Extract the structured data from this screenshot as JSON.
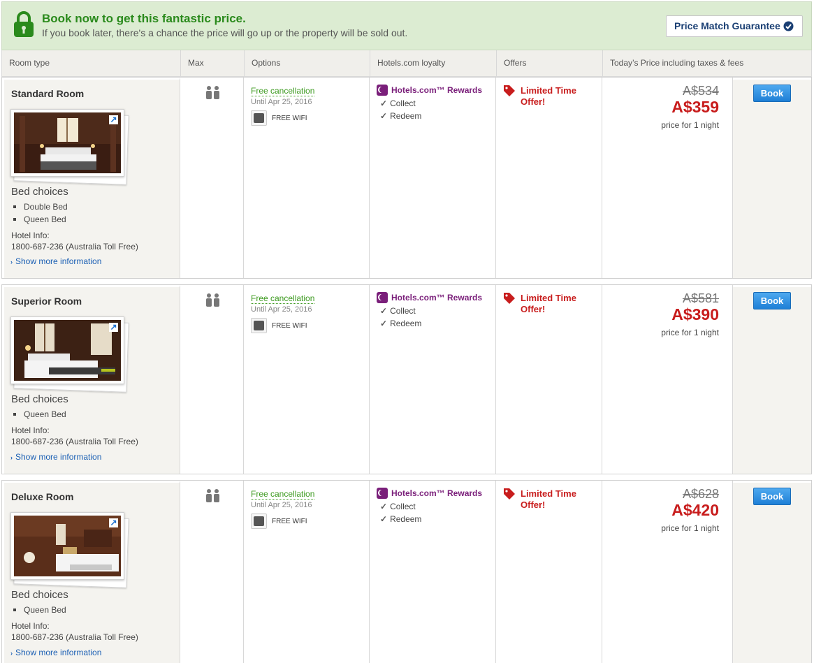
{
  "banner": {
    "title": "Book now to get this fantastic price.",
    "subtitle": "If you book later, there's a chance the price will go up or the property will be sold out.",
    "price_match_label": "Price Match Guarantee",
    "accent_color": "#2a8a1c"
  },
  "table_header": {
    "room_type": "Room type",
    "max": "Max",
    "options": "Options",
    "loyalty": "Hotels.com loyalty",
    "offers": "Offers",
    "price": "Today’s Price including taxes & fees"
  },
  "rooms": [
    {
      "name": "Standard Room",
      "bed_choices_label": "Bed choices",
      "beds": [
        "Double Bed",
        "Queen Bed"
      ],
      "hotel_info_label": "Hotel Info:",
      "hotel_phone": "1800-687-236 (Australia Toll Free)",
      "more_info": "Show more information",
      "free_cancellation": "Free cancellation",
      "until": "Until Apr 25, 2016",
      "wifi": "FREE WIFI",
      "rewards": "Hotels.com™ Rewards",
      "collect": "Collect",
      "redeem": "Redeem",
      "offer": "Limited Time Offer!",
      "old_price": "A$534",
      "new_price": "A$359",
      "per_night": "price for 1 night",
      "book": "Book"
    },
    {
      "name": "Superior Room",
      "bed_choices_label": "Bed choices",
      "beds": [
        "Queen Bed"
      ],
      "hotel_info_label": "Hotel Info:",
      "hotel_phone": "1800-687-236 (Australia Toll Free)",
      "more_info": "Show more information",
      "free_cancellation": "Free cancellation",
      "until": "Until Apr 25, 2016",
      "wifi": "FREE WIFI",
      "rewards": "Hotels.com™ Rewards",
      "collect": "Collect",
      "redeem": "Redeem",
      "offer": "Limited Time Offer!",
      "old_price": "A$581",
      "new_price": "A$390",
      "per_night": "price for 1 night",
      "book": "Book"
    },
    {
      "name": "Deluxe Room",
      "bed_choices_label": "Bed choices",
      "beds": [
        "Queen Bed"
      ],
      "hotel_info_label": "Hotel Info:",
      "hotel_phone": "1800-687-236 (Australia Toll Free)",
      "more_info": "Show more information",
      "free_cancellation": "Free cancellation",
      "until": "Until Apr 25, 2016",
      "wifi": "FREE WIFI",
      "rewards": "Hotels.com™ Rewards",
      "collect": "Collect",
      "redeem": "Redeem",
      "offer": "Limited Time Offer!",
      "old_price": "A$628",
      "new_price": "A$420",
      "per_night": "price for 1 night",
      "book": "Book"
    }
  ]
}
